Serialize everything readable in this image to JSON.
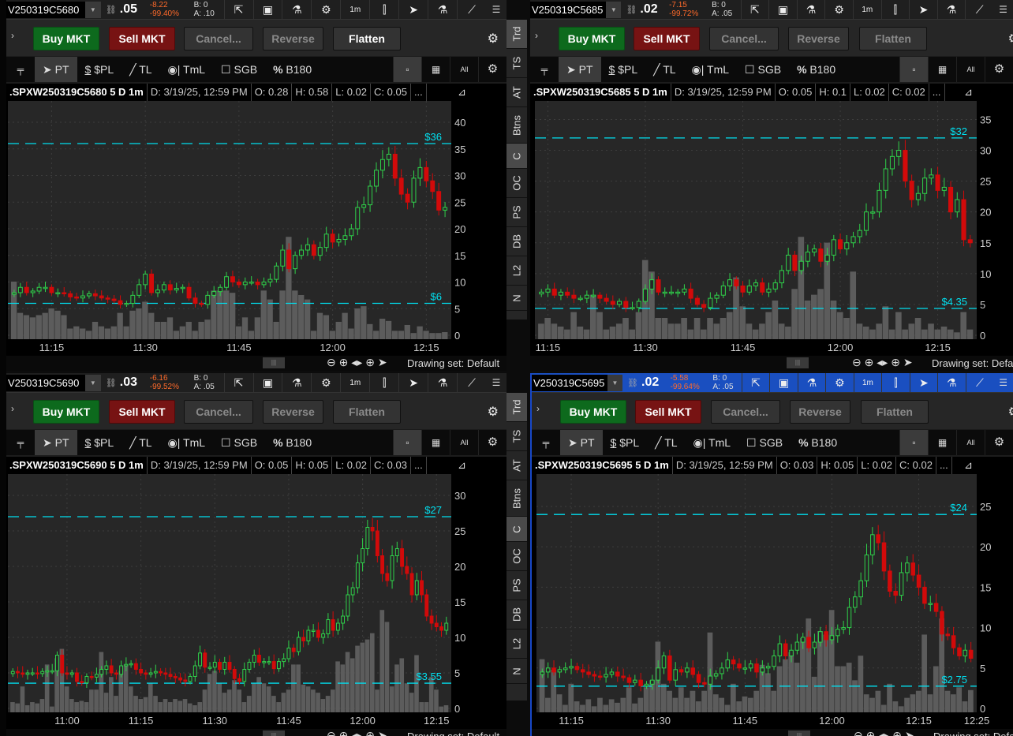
{
  "common": {
    "buy": "Buy MKT",
    "sell": "Sell MKT",
    "cancel": "Cancel...",
    "reverse": "Reverse",
    "flatten": "Flatten",
    "pt": "PT",
    "pl": "$PL",
    "tl": "TL",
    "tml": "TmL",
    "sgb": "SGB",
    "b180": "B180",
    "pct": "%",
    "dollar": "$",
    "all": "All",
    "interval": "1m",
    "more": "...",
    "drawing_set": "Drawing set: Default"
  },
  "side_tabs": [
    "Trd",
    "TS",
    "AT",
    "Btns",
    "C",
    "OC",
    "PS",
    "DB",
    "L2",
    "N"
  ],
  "panes": [
    {
      "symbol": "V250319C5680",
      "last": ".05",
      "change": "-8.22",
      "change_pct": "-99.40%",
      "bid": "B: 0",
      "ask": "A: .10",
      "flatten_enabled": true,
      "active": false,
      "info": {
        "title": ".SPXW250319C5680 5 D 1m",
        "date": "D: 3/19/25, 12:59 PM",
        "o": "O: 0.28",
        "h": "H: 0.58",
        "l": "L: 0.02",
        "c": "C: 0.05"
      }
    },
    {
      "symbol": "V250319C5685",
      "last": ".02",
      "change": "-7.15",
      "change_pct": "-99.72%",
      "bid": "B: 0",
      "ask": "A: .05",
      "flatten_enabled": false,
      "active": false,
      "info": {
        "title": ".SPXW250319C5685 5 D 1m",
        "date": "D: 3/19/25, 12:59 PM",
        "o": "O: 0.05",
        "h": "H: 0.1",
        "l": "L: 0.02",
        "c": "C: 0.02"
      }
    },
    {
      "symbol": "V250319C5690",
      "last": ".03",
      "change": "-6.16",
      "change_pct": "-99.52%",
      "bid": "B: 0",
      "ask": "A: .05",
      "flatten_enabled": false,
      "active": false,
      "info": {
        "title": ".SPXW250319C5690 5 D 1m",
        "date": "D: 3/19/25, 12:59 PM",
        "o": "O: 0.05",
        "h": "H: 0.05",
        "l": "L: 0.02",
        "c": "C: 0.03"
      }
    },
    {
      "symbol": "V250319C5695",
      "last": ".02",
      "change": "-5.58",
      "change_pct": "-99.64%",
      "bid": "B: 0",
      "ask": "A: .05",
      "flatten_enabled": false,
      "active": true,
      "info": {
        "title": ".SPXW250319C5695 5 D 1m",
        "date": "D: 3/19/25, 12:59 PM",
        "o": "O: 0.03",
        "h": "H: 0.05",
        "l": "L: 0.02",
        "c": "C: 0.02"
      }
    }
  ],
  "chart_data": [
    {
      "type": "candlestick",
      "ylim": [
        0,
        44
      ],
      "yticks": [
        0,
        5,
        10,
        15,
        20,
        25,
        30,
        35,
        40
      ],
      "levels": [
        {
          "value": 36,
          "label": "$36"
        },
        {
          "value": 6,
          "label": "$6"
        }
      ],
      "time_labels": [
        {
          "label": "11:15",
          "index": 6
        },
        {
          "label": "11:30",
          "index": 21
        },
        {
          "label": "11:45",
          "index": 36
        },
        {
          "label": "12:00",
          "index": 51
        },
        {
          "label": "12:15",
          "index": 66
        }
      ],
      "close": [
        8,
        9,
        8,
        8.3,
        9,
        9,
        8,
        8,
        7.8,
        7.2,
        7,
        7.4,
        7.8,
        7.4,
        7,
        6.8,
        6.5,
        5.8,
        6,
        7.5,
        9.5,
        11.5,
        8,
        8.5,
        9.5,
        8.5,
        8.8,
        9,
        7,
        6,
        5.8,
        7.5,
        8.2,
        9,
        11,
        10,
        9.5,
        10,
        10,
        9.5,
        10,
        10.5,
        13,
        16,
        12.5,
        15,
        16,
        17,
        15,
        16.5,
        19,
        17.5,
        18,
        18.7,
        20,
        24,
        24.5,
        28,
        31,
        33,
        34,
        29.5,
        26.5,
        25,
        29.5,
        31.5,
        29,
        27,
        23.5,
        24
      ],
      "volume": [
        12,
        5,
        4.5,
        4,
        4.5,
        5,
        6,
        5.5,
        4.5,
        1.5,
        2,
        1.5,
        1,
        3,
        2,
        1.5,
        2,
        5,
        2,
        5.5,
        6,
        7.5,
        5,
        3,
        3,
        4,
        1,
        2,
        3,
        1,
        3,
        3.5,
        10,
        10,
        10,
        9.5,
        2,
        4,
        1,
        4,
        10,
        8,
        3,
        10,
        22,
        10,
        9,
        8,
        1,
        5,
        4.5,
        1,
        3,
        5,
        1.5,
        6,
        6.5,
        2.5,
        1,
        3.7,
        3.2,
        1,
        1,
        2.3,
        0.5,
        2,
        1,
        0.5,
        0.5,
        0.7
      ]
    },
    {
      "type": "candlestick",
      "ylim": [
        0,
        38
      ],
      "yticks": [
        0,
        5,
        10,
        15,
        20,
        25,
        30,
        35
      ],
      "levels": [
        {
          "value": 32,
          "label": "$32"
        },
        {
          "value": 4.35,
          "label": "$4.35"
        }
      ],
      "time_labels": [
        {
          "label": "11:15",
          "index": 1
        },
        {
          "label": "11:30",
          "index": 16
        },
        {
          "label": "11:45",
          "index": 31
        },
        {
          "label": "12:00",
          "index": 46
        },
        {
          "label": "12:15",
          "index": 61
        }
      ],
      "close": [
        7,
        7.5,
        6.5,
        7,
        6.5,
        6,
        6,
        6.5,
        6.5,
        6,
        5.5,
        5,
        5.5,
        4.5,
        4.5,
        5.5,
        7.5,
        9,
        7,
        7,
        7,
        7,
        7.5,
        6,
        5,
        4.5,
        6,
        6.5,
        8,
        9,
        8,
        7,
        8,
        8.5,
        7,
        7.5,
        8.5,
        10.5,
        13,
        10.5,
        12,
        13.5,
        14,
        12,
        13,
        15.5,
        14,
        15,
        16,
        17,
        20,
        20,
        23.5,
        27,
        29,
        30,
        25,
        22,
        23,
        25.5,
        26,
        23.5,
        24,
        20,
        22,
        15.5,
        15
      ],
      "volume": [
        2,
        3,
        2,
        1.5,
        1,
        4,
        1.5,
        1,
        7,
        4,
        1,
        1.5,
        2,
        3,
        1,
        4,
        13,
        11,
        3,
        3,
        2,
        2,
        3,
        1,
        3,
        1,
        3,
        2,
        3,
        4,
        10,
        5,
        2,
        1,
        2,
        4,
        6,
        2,
        1.5,
        8,
        17,
        6,
        7,
        8,
        16,
        6,
        4,
        3,
        11,
        2,
        1.5,
        1,
        2,
        5,
        1,
        4,
        1,
        2,
        3,
        1,
        2,
        1,
        1.5,
        1,
        0.5,
        4,
        1
      ]
    },
    {
      "type": "candlestick",
      "ylim": [
        0,
        33
      ],
      "yticks": [
        0,
        5,
        10,
        15,
        20,
        25,
        30
      ],
      "levels": [
        {
          "value": 27,
          "label": "$27"
        },
        {
          "value": 3.55,
          "label": "$3.55"
        }
      ],
      "time_labels": [
        {
          "label": "11:00",
          "index": 11
        },
        {
          "label": "11:15",
          "index": 26
        },
        {
          "label": "11:30",
          "index": 41
        },
        {
          "label": "11:45",
          "index": 56
        },
        {
          "label": "12:00",
          "index": 71
        },
        {
          "label": "12:15",
          "index": 86
        }
      ],
      "close": [
        5.2,
        5,
        4.8,
        5,
        5,
        4.9,
        5.2,
        5.3,
        5.3,
        7.5,
        5,
        4.8,
        5,
        3.8,
        3.6,
        4.5,
        4.4,
        4.8,
        5.5,
        6,
        5,
        4.8,
        6,
        6.2,
        6.3,
        5.5,
        5,
        4.8,
        5,
        5.2,
        5,
        4.8,
        4.5,
        4.3,
        4,
        3.8,
        4.5,
        6,
        7.8,
        5.8,
        5.8,
        6.5,
        5.5,
        6.5,
        5.5,
        4.2,
        3.8,
        5.5,
        6.5,
        7.5,
        6.5,
        6.6,
        6.6,
        5.6,
        6.6,
        7,
        8.5,
        8,
        10,
        9.5,
        11,
        11,
        10,
        10.5,
        12.5,
        11,
        12,
        13,
        16,
        17,
        20.5,
        22.5,
        25.5,
        25,
        21.5,
        19,
        18,
        21.5,
        22.5,
        20,
        19,
        16,
        18,
        16,
        13,
        12,
        11.5,
        11,
        12
      ],
      "volume": [
        1,
        0.8,
        3.5,
        0.5,
        1,
        0.8,
        1.5,
        7,
        0.3,
        8,
        9.5,
        3.5,
        1.5,
        1,
        1.2,
        1,
        3,
        3,
        9,
        2.5,
        5,
        2,
        6,
        7,
        3.5,
        2,
        1.5,
        1.8,
        4,
        2,
        1,
        1.5,
        1,
        1.5,
        1.2,
        1.5,
        0.8,
        0.5,
        1,
        3,
        5.5,
        6,
        4,
        2.5,
        3,
        4.5,
        3,
        1,
        2,
        4,
        5,
        4,
        3.5,
        2,
        1,
        2.5,
        3,
        7,
        7,
        3.8,
        3.5,
        3,
        2.5,
        1.5,
        2,
        3,
        7.5,
        7,
        9,
        8,
        10,
        10.5,
        11,
        12,
        3,
        15.7,
        13.8,
        3.5,
        7,
        8,
        4,
        2.5,
        8.5,
        1,
        1,
        5,
        3,
        0.3,
        0.5
      ]
    },
    {
      "type": "candlestick",
      "ylim": [
        0,
        29
      ],
      "yticks": [
        0,
        5,
        10,
        15,
        20,
        25
      ],
      "levels": [
        {
          "value": 24,
          "label": "$24"
        },
        {
          "value": 2.75,
          "label": "$2.75"
        }
      ],
      "time_labels": [
        {
          "label": "11:15",
          "index": 5
        },
        {
          "label": "11:30",
          "index": 20
        },
        {
          "label": "11:45",
          "index": 35
        },
        {
          "label": "12:00",
          "index": 50
        },
        {
          "label": "12:15",
          "index": 65
        },
        {
          "label": "12:25",
          "index": 75
        }
      ],
      "close": [
        4.5,
        5,
        4.5,
        4.8,
        5,
        5.2,
        4.8,
        4.5,
        4.2,
        4,
        3.9,
        4.2,
        4.5,
        4,
        3.8,
        3.2,
        3.5,
        2.8,
        3,
        3.5,
        5,
        6.5,
        3.5,
        4.8,
        4.5,
        5,
        4.2,
        3.2,
        3,
        4,
        4.3,
        5,
        6,
        5.5,
        5,
        5,
        5.5,
        4.5,
        5,
        5.2,
        6.5,
        8,
        6.5,
        7.2,
        8.2,
        8.8,
        7.5,
        8.2,
        9.5,
        8.5,
        9,
        9.8,
        10,
        12.5,
        13.8,
        15.8,
        19,
        21.5,
        20.5,
        17,
        14.5,
        14,
        16.8,
        18,
        16.5,
        15,
        13,
        13,
        12,
        9.2,
        9,
        7.5,
        6.5,
        7.2,
        6.2
      ],
      "volume": [
        7,
        1.5,
        5.5,
        2,
        0.5,
        3.5,
        1,
        0.5,
        1.3,
        0.3,
        1.5,
        0.5,
        1.3,
        0.8,
        1.5,
        3,
        0.7,
        1.5,
        3,
        4,
        9.5,
        3.5,
        2.5,
        1.5,
        3,
        1.5,
        2.5,
        1,
        2.5,
        10.8,
        2,
        1.5,
        0.5,
        3.5,
        1,
        1.7,
        1.5,
        2.5,
        6.2,
        5,
        2.5,
        6,
        7,
        8,
        6.5,
        10,
        12.8,
        4.5,
        11,
        10.5,
        14,
        6,
        6,
        6.5,
        4,
        7.5,
        2,
        1.5,
        2.5,
        0.5,
        3.5,
        1,
        0.3,
        1.5,
        2,
        2.5,
        10.5,
        2,
        6,
        12.8,
        2.5,
        2,
        3,
        1,
        2.6
      ]
    }
  ],
  "colors": {
    "up": "#2fd14a",
    "down": "#d20a0a",
    "level": "#00e0f0",
    "volume": "#5c5c5c",
    "active_header": "#1a4fc0"
  }
}
